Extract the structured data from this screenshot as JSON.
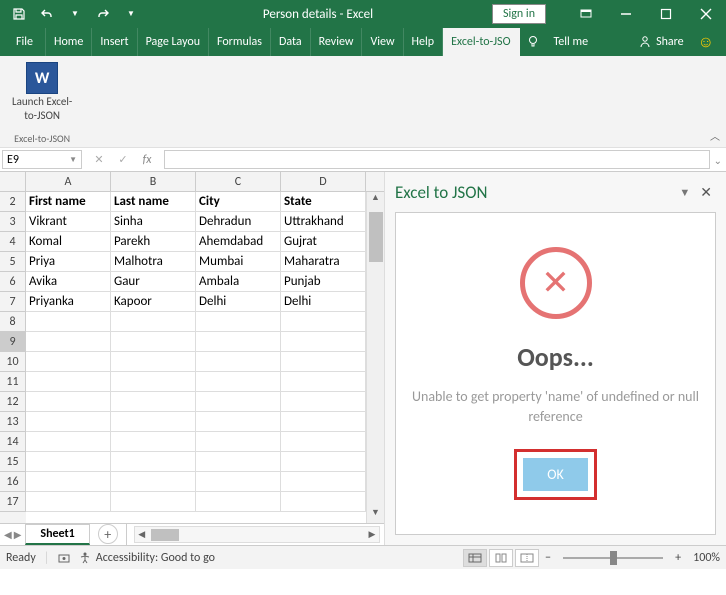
{
  "titlebar": {
    "title": "Person details - Excel",
    "signin": "Sign in"
  },
  "tabs": {
    "file": "File",
    "home": "Home",
    "insert": "Insert",
    "pagelayout": "Page Layou",
    "formulas": "Formulas",
    "data": "Data",
    "review": "Review",
    "view": "View",
    "help": "Help",
    "addin": "Excel-to-JSO",
    "tellme": "Tell me",
    "share": "Share"
  },
  "ribbon": {
    "launch_line1": "Launch Excel-",
    "launch_line2": "to-JSON",
    "group_label": "Excel-to-JSON"
  },
  "namebox": {
    "value": "E9"
  },
  "columns": [
    "A",
    "B",
    "C",
    "D"
  ],
  "row_start": 2,
  "row_count": 16,
  "sheet": {
    "headers": [
      "First name",
      "Last name",
      "City",
      "State"
    ],
    "rows": [
      [
        "Vikrant",
        "Sinha",
        "Dehradun",
        "Uttrakhand"
      ],
      [
        "Komal",
        "Parekh",
        "Ahemdabad",
        "Gujrat"
      ],
      [
        "Priya",
        "Malhotra",
        "Mumbai",
        "Maharatra"
      ],
      [
        "Avika",
        "Gaur",
        "Ambala",
        "Punjab"
      ],
      [
        "Priyanka",
        "Kapoor",
        "Delhi",
        "Delhi"
      ]
    ],
    "tab_name": "Sheet1"
  },
  "taskpane": {
    "title": "Excel to JSON",
    "oops": "Oops...",
    "message": "Unable to get property 'name' of undefined or null reference",
    "ok": "OK"
  },
  "statusbar": {
    "ready": "Ready",
    "accessibility": "Accessibility: Good to go",
    "zoom": "100%"
  }
}
